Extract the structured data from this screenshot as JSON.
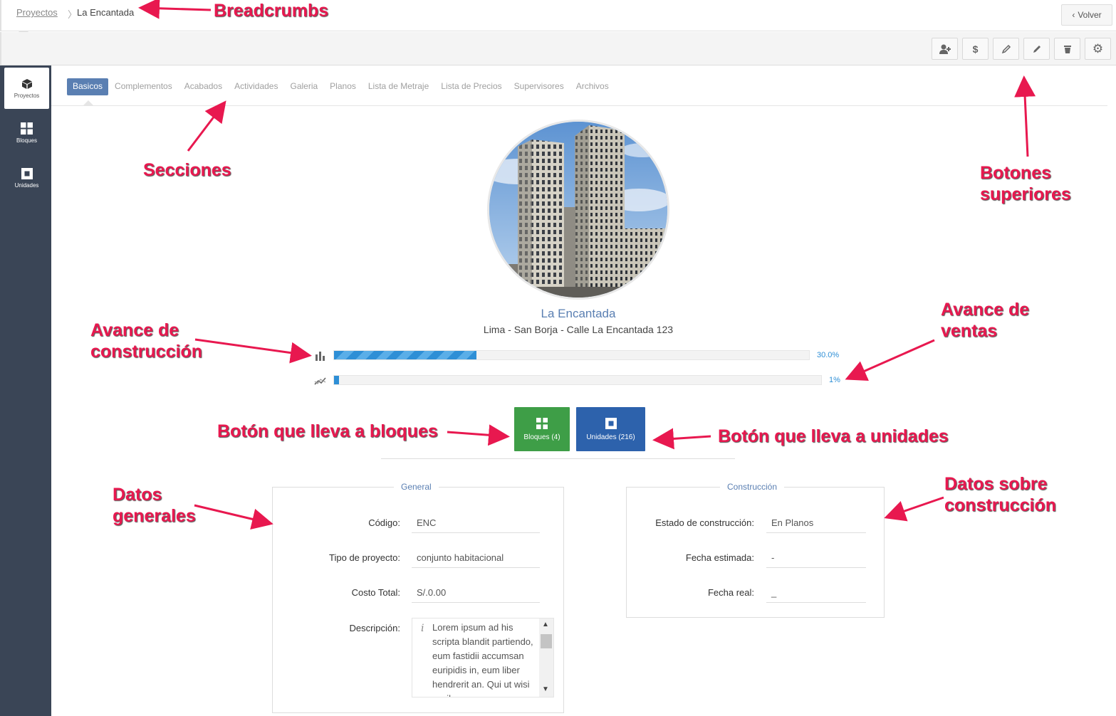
{
  "breadcrumb": {
    "parent": "Proyectos",
    "separator": "〉",
    "current": "La Encantada"
  },
  "back_button": {
    "label": "Volver"
  },
  "toolbar": {
    "buttons": [
      {
        "icon": "add-user-icon",
        "glyph": "👤+"
      },
      {
        "icon": "dollar-icon",
        "glyph": "$"
      },
      {
        "icon": "pencil-alt-icon",
        "glyph": "✎"
      },
      {
        "icon": "pencil-icon",
        "glyph": "✏"
      },
      {
        "icon": "trash-icon",
        "glyph": "🗑"
      },
      {
        "icon": "gear-icon",
        "glyph": "⚙"
      }
    ]
  },
  "sidebar": {
    "items": [
      {
        "label": "Proyectos",
        "icon": "cube-icon"
      },
      {
        "label": "Bloques",
        "icon": "grid-icon"
      },
      {
        "label": "Unidades",
        "icon": "square-icon"
      }
    ]
  },
  "tabs": [
    "Basicos",
    "Complementos",
    "Acabados",
    "Actividades",
    "Galeria",
    "Planos",
    "Lista de Metraje",
    "Lista de Precios",
    "Supervisores",
    "Archivos"
  ],
  "project": {
    "name": "La Encantada",
    "address": "Lima - San Borja - Calle La Encantada 123"
  },
  "progress": {
    "construction": {
      "label": "30.0%",
      "value": 0.3
    },
    "sales": {
      "label": "1%",
      "value": 0.01
    }
  },
  "buttons": {
    "bloques": "Bloques (4)",
    "unidades": "Unidades (216)"
  },
  "general": {
    "legend": "General",
    "codigo_label": "Código:",
    "codigo": "ENC",
    "tipo_label": "Tipo de proyecto:",
    "tipo": "conjunto habitacional",
    "costo_label": "Costo Total:",
    "costo": "S/.0.00",
    "descripcion_label": "Descripción:",
    "descripcion": "Lorem ipsum ad his scripta blandit partiendo, eum fastidii accumsan euripidis in, eum liber hendrerit an. Qui ut wisi vocibus"
  },
  "construccion": {
    "legend": "Construcción",
    "estado_label": "Estado de construcción:",
    "estado": "En Planos",
    "fecha_estimada_label": "Fecha estimada:",
    "fecha_estimada": "-",
    "fecha_real_label": "Fecha real:",
    "fecha_real": "_"
  },
  "annotations": {
    "breadcrumbs": "Breadcrumbs",
    "secciones": "Secciones",
    "botones_superiores_1": "Botones",
    "botones_superiores_2": "superiores",
    "avance_construccion_1": "Avance de",
    "avance_construccion_2": "construcción",
    "avance_ventas_1": "Avance de",
    "avance_ventas_2": "ventas",
    "boton_bloques": "Botón que lleva a bloques",
    "boton_unidades": "Botón que lleva a unidades",
    "datos_generales_1": "Datos",
    "datos_generales_2": "generales",
    "datos_construccion_1": "Datos sobre",
    "datos_construccion_2": "construcción"
  },
  "colors": {
    "sidebar": "#3a4556",
    "accent": "#5a7fb2",
    "progress": "#2e8fd6",
    "green_button": "#3e9e47",
    "blue_button": "#2d62ac",
    "annotation": "#e8184f"
  }
}
